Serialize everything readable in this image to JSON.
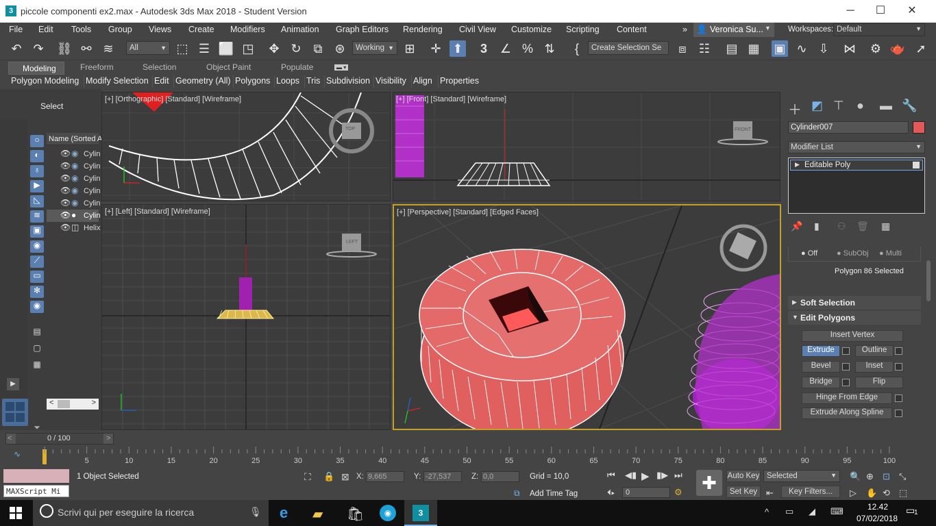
{
  "window": {
    "title": "piccole componenti ex2.max - Autodesk 3ds Max 2018 - Student Version",
    "min": "─",
    "max": "☐",
    "close": "✕"
  },
  "menu": [
    "File",
    "Edit",
    "Tools",
    "Group",
    "Views",
    "Create",
    "Modifiers",
    "Animation",
    "Graph Editors",
    "Rendering",
    "Civil View",
    "Customize",
    "Scripting",
    "Content"
  ],
  "menu_more": "»",
  "user": "Veronica Su...",
  "workspaces_label": "Workspaces:",
  "workspace": "Default",
  "toolbar": {
    "filter": "All",
    "refcoord": "Working",
    "selset": "Create Selection Se",
    "snap3": "3"
  },
  "ribbon_tabs": [
    "Modeling",
    "Freeform",
    "Selection",
    "Object Paint",
    "Populate"
  ],
  "ribbon_items": [
    "Polygon Modeling",
    "Modify Selection",
    "Edit",
    "Geometry (All)",
    "Polygons",
    "Loops",
    "Tris",
    "Subdivision",
    "Visibility",
    "Align",
    "Properties"
  ],
  "scene": {
    "select_label": "Select",
    "header": "Name (Sorted A",
    "items": [
      "Cylin",
      "Cylin",
      "Cylin",
      "Cylin",
      "Cylin",
      "Cylin",
      "Helix"
    ]
  },
  "viewports": {
    "top": "[+] [Orthographic] [Standard] [Wireframe]",
    "front": "[+] [Front] [Standard] [Wireframe]",
    "left": "[+] [Left] [Standard] [Wireframe]",
    "persp": "[+] [Perspective] [Standard] [Edged Faces]",
    "cube_top": "TOP",
    "cube_front": "FRONT",
    "cube_left": "LEFT"
  },
  "command": {
    "object_name": "Cylinder007",
    "modifier_list": "Modifier List",
    "stack_item": "Editable Poly",
    "sel_opts": [
      "Off",
      "SubObj",
      "Multi"
    ],
    "selected_info": "Polygon 86 Selected",
    "rollout_soft": "Soft Selection",
    "rollout_edit": "Edit Polygons",
    "insert_vertex": "Insert Vertex",
    "extrude": "Extrude",
    "outline": "Outline",
    "bevel": "Bevel",
    "inset": "Inset",
    "bridge": "Bridge",
    "flip": "Flip",
    "hinge": "Hinge From Edge",
    "extrude_spline": "Extrude Along Spline"
  },
  "timeline": {
    "frame": "0 / 100",
    "ticks": [
      "0",
      "5",
      "10",
      "15",
      "20",
      "25",
      "30",
      "35",
      "40",
      "45",
      "50",
      "55",
      "60",
      "65",
      "70",
      "75",
      "80",
      "85",
      "90",
      "95",
      "100"
    ]
  },
  "status": {
    "maxscript": "MAXScript Mi",
    "selected": "1 Object Selected",
    "x_label": "X:",
    "x": "9,665",
    "y_label": "Y:",
    "y": "-27,537",
    "z_label": "Z:",
    "z": "0,0",
    "grid": "Grid = 10,0",
    "add_time_tag": "Add Time Tag",
    "auto_key": "Auto Key",
    "set_key": "Set Key",
    "key_mode": "Selected",
    "key_filters": "Key Filters...",
    "frame": "0"
  },
  "taskbar": {
    "search": "Scrivi qui per eseguire la ricerca",
    "time": "12.42",
    "date": "07/02/2018",
    "notif": "1"
  },
  "colors": {
    "accent": "#5b7fb0",
    "object_color": "#e05a5a",
    "purple": "#b030c8",
    "selection_red": "#e06060"
  }
}
